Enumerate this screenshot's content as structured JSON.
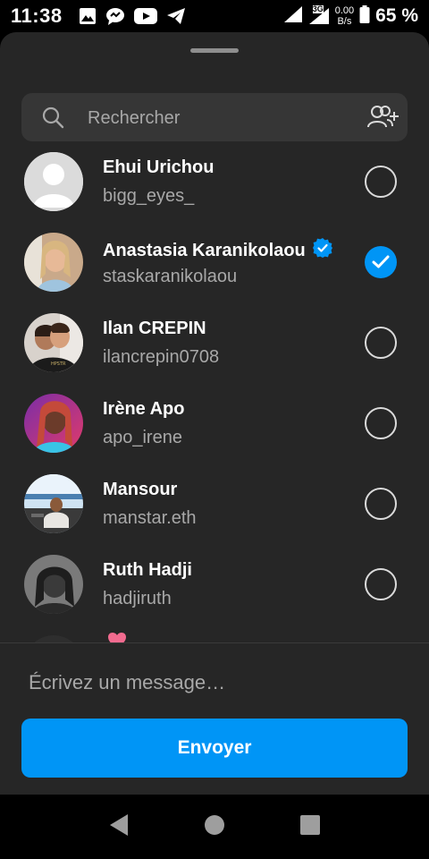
{
  "status_bar": {
    "time": "11:38",
    "net_speed_value": "0.00",
    "net_speed_unit": "B/s",
    "network": "3G",
    "battery": "65 %"
  },
  "search": {
    "placeholder": "Rechercher"
  },
  "contacts": [
    {
      "name": "Ehui Urichou",
      "username": "bigg_eyes_",
      "selected": false,
      "verified": false
    },
    {
      "name": "Anastasia Karanikolaou",
      "username": "staskaranikolaou",
      "selected": true,
      "verified": true
    },
    {
      "name": "Ilan CREPIN",
      "username": "ilancrepin0708",
      "selected": false,
      "verified": false
    },
    {
      "name": "Irène Apo",
      "username": "apo_irene",
      "selected": false,
      "verified": false
    },
    {
      "name": "Mansour",
      "username": "manstar.eth",
      "selected": false,
      "verified": false
    },
    {
      "name": "Ruth Hadji",
      "username": "hadjiruth",
      "selected": false,
      "verified": false
    }
  ],
  "message": {
    "placeholder": "Écrivez un message…"
  },
  "send_label": "Envoyer",
  "colors": {
    "accent": "#0095f6",
    "sheet_bg": "#262626",
    "search_bg": "#363636",
    "secondary_text": "#a8a8a8"
  }
}
